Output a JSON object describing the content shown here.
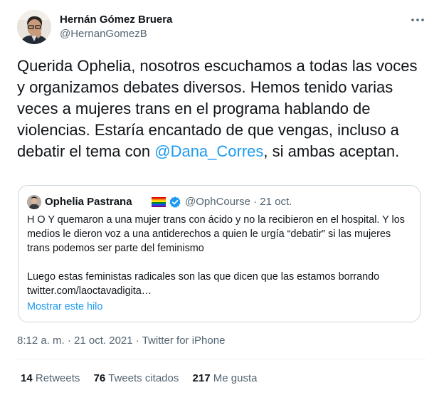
{
  "author": {
    "name": "Hernán Gómez Bruera",
    "handle": "@HernanGomezB"
  },
  "tweet": {
    "text_before_mention": "Querida Ophelia, nosotros escuchamos a todas las voces y organizamos debates diversos. Hemos tenido varias veces a mujeres trans en el programa hablando de violencias. Estaría encantado de que vengas, incluso a debatir el tema con ",
    "mention": "@Dana_Corres",
    "text_after_mention": ", si ambas aceptan."
  },
  "quoted_tweet": {
    "name": "Ophelia Pastrana",
    "handle_date": "@OphCourse · 21 oct.",
    "paragraph_1": "H O Y quemaron a una mujer trans con ácido y no la recibieron en el hospital. Y los medios le dieron voz a una antiderechos a quien le urgía “debatir” si las mujeres trans podemos ser parte del feminismo",
    "paragraph_2": "Luego estas feministas radicales son las que dicen que las estamos borrando twitter.com/laoctavadigita…",
    "show_thread": "Mostrar este hilo"
  },
  "meta": {
    "time_date": "8:12 a. m. · 21 oct. 2021",
    "separator": "·",
    "source": "Twitter for iPhone"
  },
  "stats": {
    "retweets_count": "14",
    "retweets_label": "Retweets",
    "quotes_count": "76",
    "quotes_label": "Tweets citados",
    "likes_count": "217",
    "likes_label": "Me gusta"
  },
  "colors": {
    "text": "#0f1419",
    "secondary": "#536471",
    "link": "#1d9bf0",
    "border": "#cfd9de"
  },
  "icons": {
    "more": "more-dots-icon",
    "verified": "verified-badge-icon",
    "flag": "rainbow-flag-icon"
  }
}
